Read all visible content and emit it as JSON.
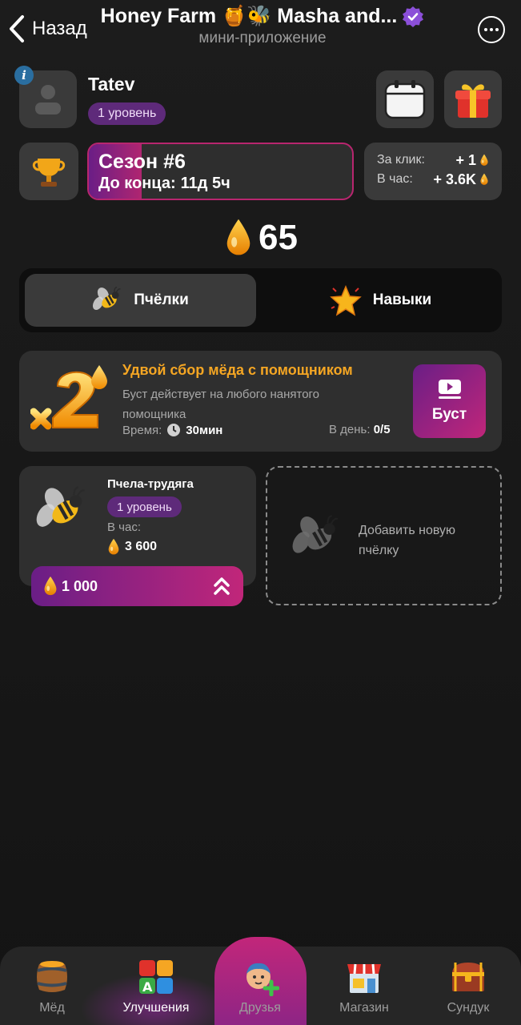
{
  "header": {
    "back_label": "Назад",
    "title": "Honey Farm 🍯🐝 Masha and...",
    "subtitle": "мини-приложение"
  },
  "profile": {
    "username": "Tatev",
    "level": "1 уровень",
    "info_badge": "i"
  },
  "season": {
    "title": "Сезон #6",
    "remaining_label": "До конца:",
    "remaining_value": "11д 5ч",
    "progress_fraction": 0.2
  },
  "rates": {
    "per_click_label": "За клик:",
    "per_click_value": "+ 1",
    "per_hour_label": "В час:",
    "per_hour_value": "+ 3.6K"
  },
  "balance": "65",
  "tabs": [
    {
      "label": "Пчёлки",
      "active": true
    },
    {
      "label": "Навыки",
      "active": false
    }
  ],
  "boost": {
    "title": "Удвой сбор мёда с помощником",
    "description": "Буст действует на любого нанятого помощника",
    "time_label": "Время:",
    "time_value": "30мин",
    "per_day_label": "В день:",
    "per_day_value": "0/5",
    "button_label": "Буст"
  },
  "bee": {
    "name": "Пчела-трудяга",
    "level": "1 уровень",
    "per_hour_label": "В час:",
    "income": "3 600",
    "upgrade_cost": "1 000"
  },
  "add_bee_label": "Добавить новую пчёлку",
  "nav": [
    {
      "label": "Мёд",
      "icon": "barrel-icon",
      "active": false
    },
    {
      "label": "Улучшения",
      "icon": "abc-blocks-icon",
      "active": true
    },
    {
      "label": "Друзья",
      "icon": "friend-add-icon",
      "active": false
    },
    {
      "label": "Магазин",
      "icon": "shop-icon",
      "active": false
    },
    {
      "label": "Сундук",
      "icon": "chest-icon",
      "active": false
    }
  ],
  "colors": {
    "accent_purple": "#6a1e86",
    "accent_pink": "#c1267a",
    "honey_orange": "#f5a623",
    "card_bg": "#2f2f2f"
  }
}
